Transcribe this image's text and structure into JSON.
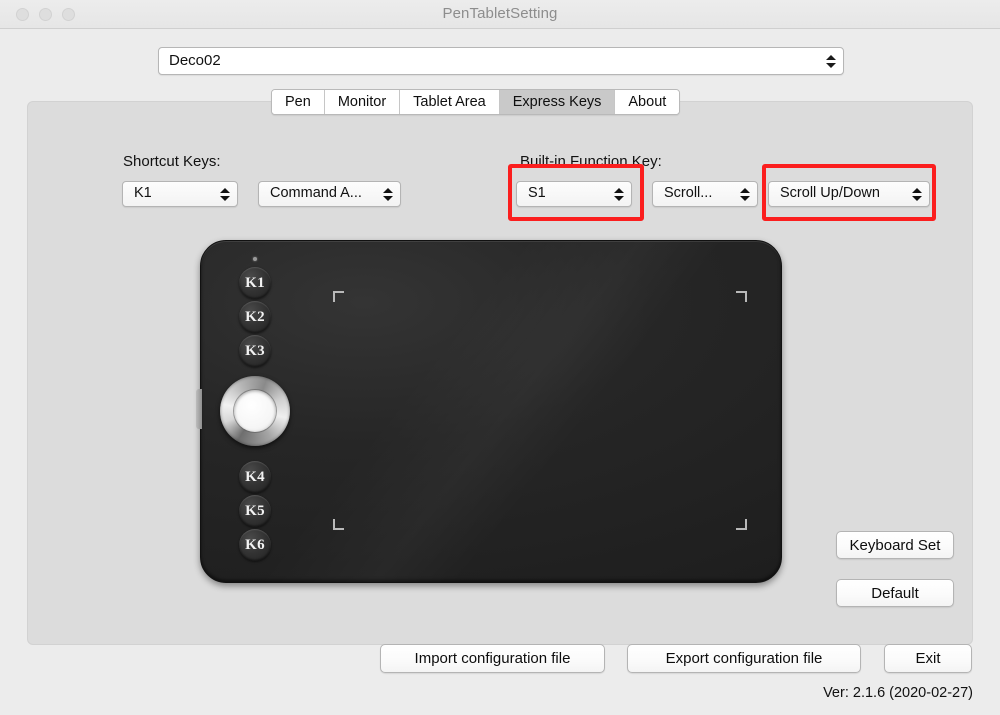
{
  "window": {
    "title": "PenTabletSetting",
    "traffic_lights": [
      "close",
      "minimize",
      "maximize"
    ]
  },
  "device_select": {
    "value": "Deco02",
    "icon": "stepper-updown-icon"
  },
  "tabs": [
    {
      "label": "Pen",
      "active": false
    },
    {
      "label": "Monitor",
      "active": false
    },
    {
      "label": "Tablet Area",
      "active": false
    },
    {
      "label": "Express Keys",
      "active": true
    },
    {
      "label": "About",
      "active": false
    }
  ],
  "shortcut_section": {
    "label": "Shortcut Keys:",
    "key_select": {
      "value": "K1"
    },
    "action_select": {
      "value": "Command  A..."
    }
  },
  "builtin_section": {
    "label": "Built-in Function Key:",
    "key_select": {
      "value": "S1"
    },
    "mode_select": {
      "value": "Scroll..."
    },
    "action_select": {
      "value": "Scroll Up/Down"
    }
  },
  "highlights": {
    "color": "#fb1e1e",
    "boxes": [
      "builtin-key-select",
      "builtin-action-select"
    ]
  },
  "tablet": {
    "name": "Deco02 tablet illustration",
    "shortcut_keys": [
      "K1",
      "K2",
      "K3",
      "K4",
      "K5",
      "K6"
    ],
    "ring": "scroll-ring",
    "led": "status-led"
  },
  "side_buttons": {
    "keyboard_set": "Keyboard Set",
    "default": "Default"
  },
  "bottom_buttons": {
    "import": "Import configuration file",
    "export": "Export configuration file",
    "exit": "Exit"
  },
  "version": "Ver: 2.1.6 (2020-02-27)"
}
